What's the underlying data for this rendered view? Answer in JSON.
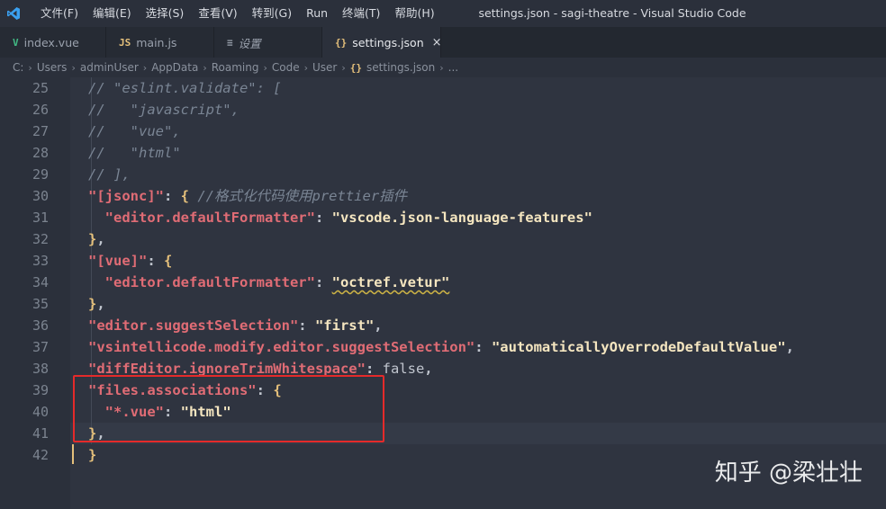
{
  "titlebar": {
    "menu": [
      "文件(F)",
      "编辑(E)",
      "选择(S)",
      "查看(V)",
      "转到(G)",
      "Run",
      "终端(T)",
      "帮助(H)"
    ],
    "title": "settings.json - sagi-theatre - Visual Studio Code"
  },
  "tabs": [
    {
      "label": "index.vue",
      "icon": "V",
      "icon_name": "vue-icon",
      "color": "#41b883"
    },
    {
      "label": "main.js",
      "icon": "JS",
      "icon_name": "js-icon",
      "color": "#e5c07b"
    },
    {
      "label": "设置",
      "icon": "≡",
      "icon_name": "settings-icon",
      "color": "#9aa1ad"
    },
    {
      "label": "settings.json",
      "icon": "{}",
      "icon_name": "json-icon",
      "color": "#e5c07b",
      "active": true,
      "close": "×"
    }
  ],
  "breadcrumb": {
    "parts": [
      "C:",
      "Users",
      "adminUser",
      "AppData",
      "Roaming",
      "Code",
      "User"
    ],
    "file_icon": "{}",
    "file": "settings.json",
    "more": "..."
  },
  "editor": {
    "line_numbers": [
      "25",
      "26",
      "27",
      "28",
      "29",
      "30",
      "31",
      "32",
      "33",
      "34",
      "35",
      "36",
      "37",
      "38",
      "39",
      "40",
      "41",
      "42"
    ],
    "lines": [
      [
        {
          "t": "// \"eslint.validate\": [",
          "c": "comment"
        }
      ],
      [
        {
          "t": "//   \"javascript\",",
          "c": "comment"
        }
      ],
      [
        {
          "t": "//   \"vue\",",
          "c": "comment"
        }
      ],
      [
        {
          "t": "//   \"html\"",
          "c": "comment"
        }
      ],
      [
        {
          "t": "// ],",
          "c": "comment"
        }
      ],
      [
        {
          "t": "\"[jsonc]\"",
          "c": "key"
        },
        {
          "t": ": ",
          "c": "punc"
        },
        {
          "t": "{",
          "c": "brace"
        },
        {
          "t": " //格式化代码使用prettier插件",
          "c": "comment"
        }
      ],
      [
        {
          "t": "  \"editor.defaultFormatter\"",
          "c": "key"
        },
        {
          "t": ": ",
          "c": "punc"
        },
        {
          "t": "\"vscode.json-language-features\"",
          "c": "str"
        }
      ],
      [
        {
          "t": "}",
          "c": "brace"
        },
        {
          "t": ",",
          "c": "punc"
        }
      ],
      [
        {
          "t": "\"[vue]\"",
          "c": "key"
        },
        {
          "t": ": ",
          "c": "punc"
        },
        {
          "t": "{",
          "c": "brace"
        }
      ],
      [
        {
          "t": "  \"editor.defaultFormatter\"",
          "c": "key"
        },
        {
          "t": ": ",
          "c": "punc"
        },
        {
          "t": "\"octref.vetur\"",
          "c": "str squiggle"
        }
      ],
      [
        {
          "t": "}",
          "c": "brace"
        },
        {
          "t": ",",
          "c": "punc"
        }
      ],
      [
        {
          "t": "\"editor.suggestSelection\"",
          "c": "key"
        },
        {
          "t": ": ",
          "c": "punc"
        },
        {
          "t": "\"first\"",
          "c": "str"
        },
        {
          "t": ",",
          "c": "punc"
        }
      ],
      [
        {
          "t": "\"vsintellicode.modify.editor.suggestSelection\"",
          "c": "key"
        },
        {
          "t": ": ",
          "c": "punc"
        },
        {
          "t": "\"automaticallyOverrodeDefaultValue\"",
          "c": "str"
        },
        {
          "t": ",",
          "c": "punc"
        }
      ],
      [
        {
          "t": "\"diffEditor.ignoreTrimWhitespace\"",
          "c": "key"
        },
        {
          "t": ": ",
          "c": "punc"
        },
        {
          "t": "false",
          "c": "kw"
        },
        {
          "t": ",",
          "c": "punc"
        }
      ],
      [
        {
          "t": "\"files.associations\"",
          "c": "key"
        },
        {
          "t": ": ",
          "c": "punc"
        },
        {
          "t": "{",
          "c": "brace"
        }
      ],
      [
        {
          "t": "  \"*.vue\"",
          "c": "key"
        },
        {
          "t": ": ",
          "c": "punc"
        },
        {
          "t": "\"html\"",
          "c": "str"
        }
      ],
      [
        {
          "t": "}",
          "c": "brace"
        },
        {
          "t": ",",
          "c": "punc"
        }
      ],
      [
        {
          "t": "}",
          "c": "brace"
        }
      ]
    ],
    "cursor_line": 41
  },
  "watermark": "知乎 @梁壮壮",
  "colors": {
    "highlight_box": "#e52a2a",
    "key": "#e06c75",
    "string": "#f5e6c0",
    "brace": "#e5c07b",
    "comment": "#7a8594"
  }
}
